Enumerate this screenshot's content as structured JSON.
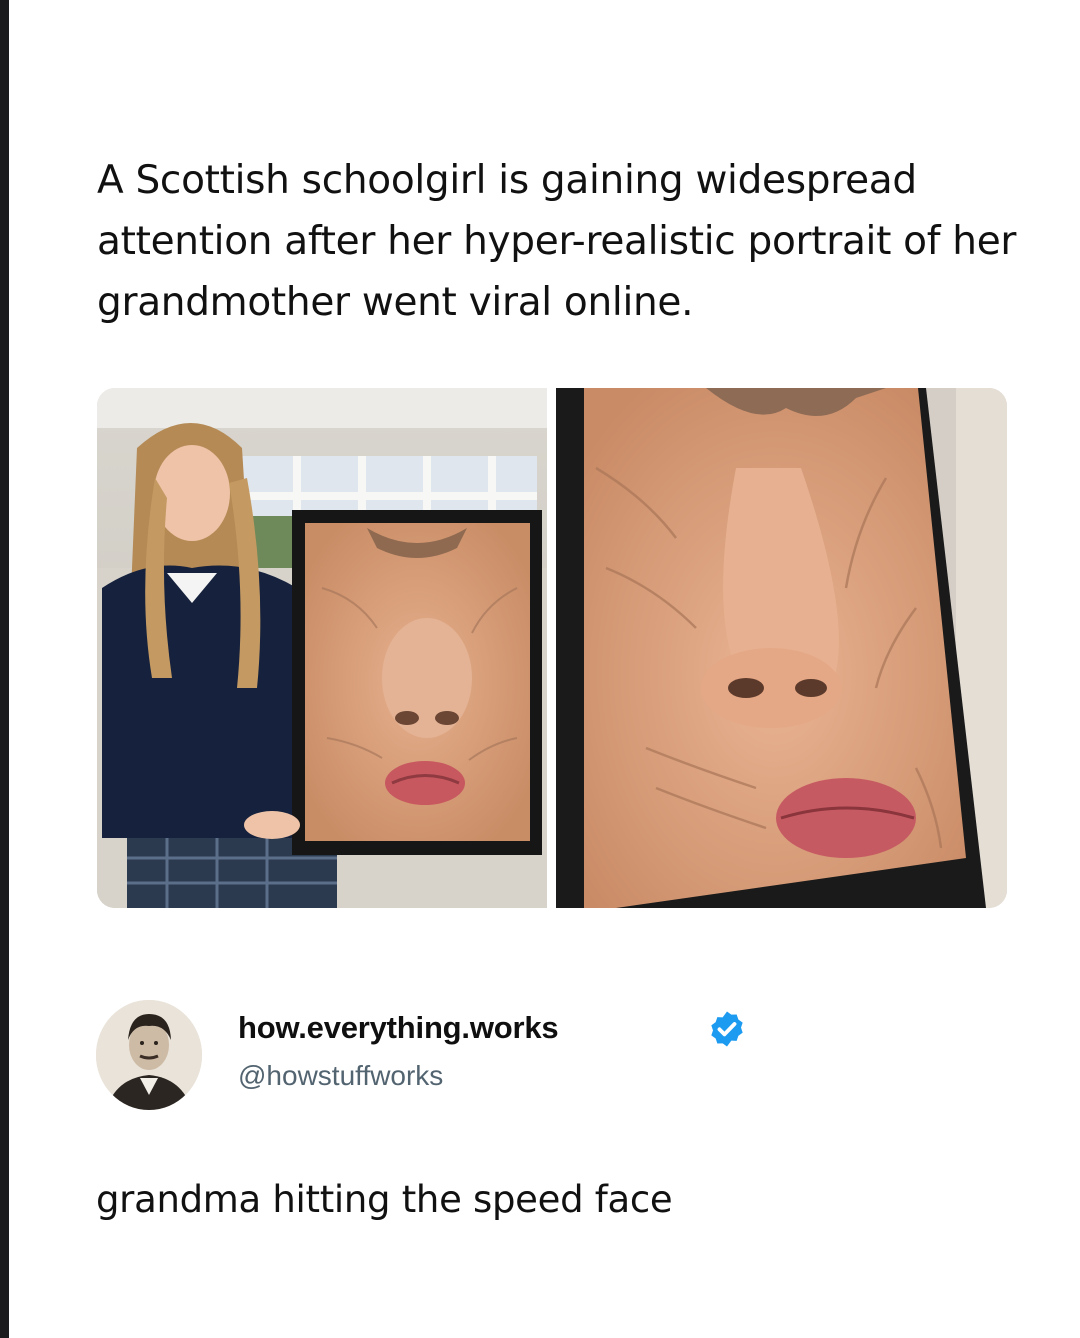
{
  "quoted_post": {
    "headline": "A Scottish schoolgirl is gaining widespread attention after her hyper-realistic portrait of her grandmother went viral online."
  },
  "media": [
    {
      "icon": "photo-student-holding-portrait"
    },
    {
      "icon": "photo-portrait-closeup"
    }
  ],
  "post": {
    "author": {
      "display_name": "how.everything.works",
      "handle": "@howstuffworks",
      "verified": true,
      "avatar_icon": "avatar-portrait"
    },
    "text": "grandma hitting the speed face"
  },
  "colors": {
    "text": "#111111",
    "handle": "#536471",
    "verified": "#1d9bf0",
    "skin": "#e0a683"
  }
}
